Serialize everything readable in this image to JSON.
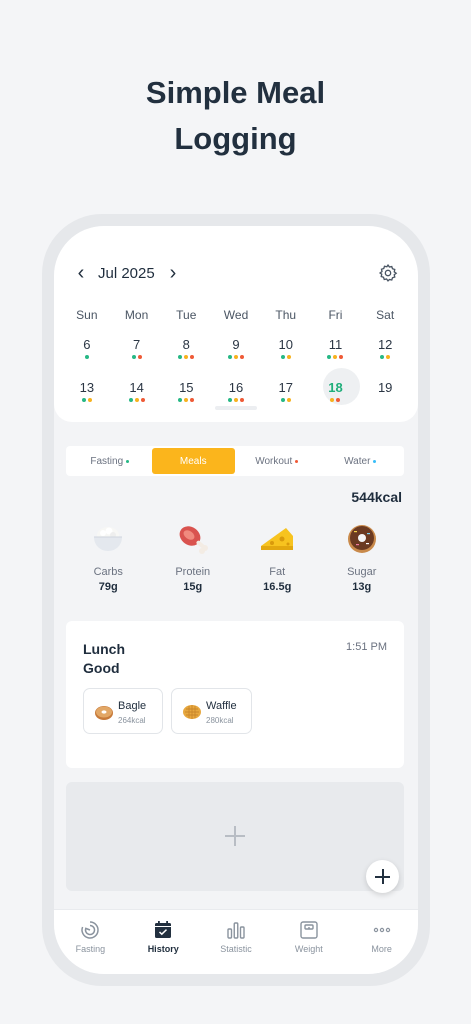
{
  "headline": {
    "line1": "Simple Meal",
    "line2": "Logging"
  },
  "calendar": {
    "month": "Jul 2025",
    "prev_icon": "chevron-left-icon",
    "next_icon": "chevron-right-icon",
    "settings_icon": "gear-icon",
    "weekdays": [
      "Sun",
      "Mon",
      "Tue",
      "Wed",
      "Thu",
      "Fri",
      "Sat"
    ],
    "week1": [
      {
        "day": "6",
        "dots": [
          "green"
        ]
      },
      {
        "day": "7",
        "dots": [
          "green",
          "red"
        ]
      },
      {
        "day": "8",
        "dots": [
          "green",
          "yellow",
          "red"
        ]
      },
      {
        "day": "9",
        "dots": [
          "green",
          "yellow",
          "red"
        ]
      },
      {
        "day": "10",
        "dots": [
          "green",
          "yellow"
        ]
      },
      {
        "day": "11",
        "dots": [
          "green",
          "yellow",
          "red"
        ]
      },
      {
        "day": "12",
        "dots": [
          "green",
          "yellow"
        ]
      }
    ],
    "week2": [
      {
        "day": "13",
        "dots": [
          "green",
          "yellow"
        ]
      },
      {
        "day": "14",
        "dots": [
          "green",
          "yellow",
          "red"
        ]
      },
      {
        "day": "15",
        "dots": [
          "green",
          "yellow",
          "red"
        ]
      },
      {
        "day": "16",
        "dots": [
          "green",
          "yellow",
          "red"
        ]
      },
      {
        "day": "17",
        "dots": [
          "green",
          "yellow"
        ]
      },
      {
        "day": "18",
        "dots": [
          "yellow",
          "red"
        ],
        "today": true
      },
      {
        "day": "19",
        "dots": []
      }
    ]
  },
  "tabs": [
    {
      "label": "Fasting",
      "dot": "#26b885",
      "active": false
    },
    {
      "label": "Meals",
      "dot": "",
      "active": true
    },
    {
      "label": "Workout",
      "dot": "#ef5a36",
      "active": false
    },
    {
      "label": "Water",
      "dot": "#38bdf8",
      "active": false
    }
  ],
  "summary": {
    "kcal": "544kcal"
  },
  "macros": [
    {
      "name": "Carbs",
      "value": "79g",
      "icon": "rice-bowl-icon"
    },
    {
      "name": "Protein",
      "value": "15g",
      "icon": "meat-icon"
    },
    {
      "name": "Fat",
      "value": "16.5g",
      "icon": "cheese-icon"
    },
    {
      "name": "Sugar",
      "value": "13g",
      "icon": "donut-icon"
    }
  ],
  "meal": {
    "name": "Lunch",
    "rating": "Good",
    "time": "1:51 PM",
    "foods": [
      {
        "name": "Bagle",
        "kcal": "264kcal",
        "icon": "bagel-icon"
      },
      {
        "name": "Waffle",
        "kcal": "280kcal",
        "icon": "waffle-icon"
      }
    ]
  },
  "actions": {
    "add_icon": "plus-icon",
    "fab_icon": "plus-icon"
  },
  "nav": [
    {
      "label": "Fasting",
      "icon": "timer-icon",
      "active": false
    },
    {
      "label": "History",
      "icon": "calendar-check-icon",
      "active": true
    },
    {
      "label": "Statistic",
      "icon": "bar-chart-icon",
      "active": false
    },
    {
      "label": "Weight",
      "icon": "scale-icon",
      "active": false
    },
    {
      "label": "More",
      "icon": "more-dots-icon",
      "active": false
    }
  ],
  "colors": {
    "accent": "#fbb51c",
    "today": "#1fae7a",
    "text": "#1f2d3d"
  }
}
